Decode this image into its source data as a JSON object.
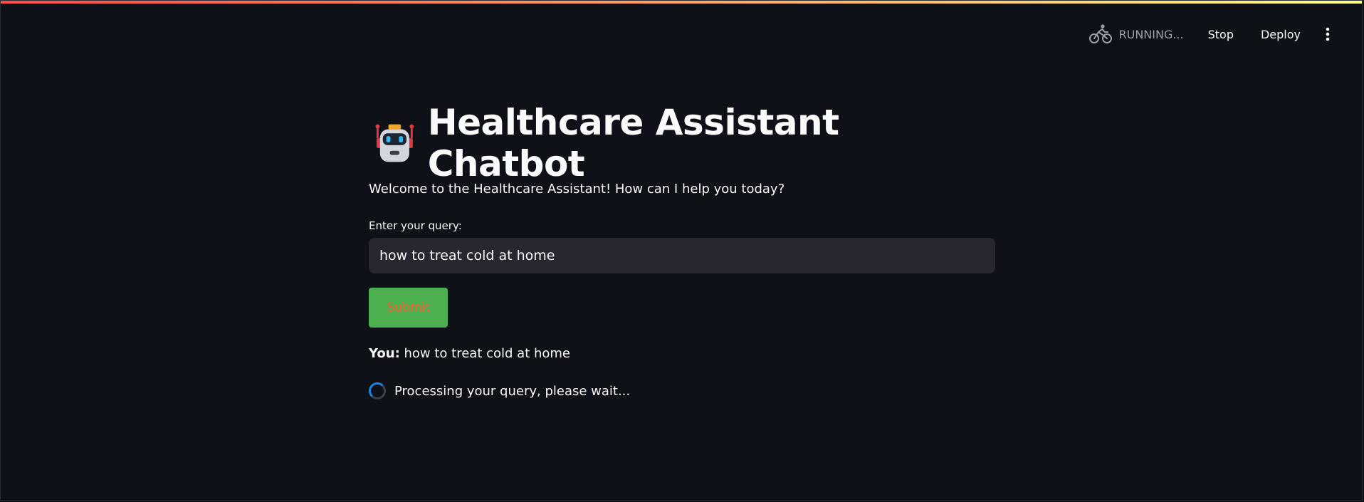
{
  "header": {
    "status_text": "RUNNING...",
    "stop_label": "Stop",
    "deploy_label": "Deploy"
  },
  "main": {
    "title": "Healthcare Assistant Chatbot",
    "title_icon": "robot-icon",
    "welcome": "Welcome to the Healthcare Assistant! How can I help you today?",
    "input_label": "Enter your query:",
    "query_value": "how to treat cold at home",
    "submit_label": "Submit",
    "you_prefix": "You:",
    "you_query": "how to treat cold at home",
    "processing_text": "Processing your query, please wait..."
  },
  "colors": {
    "background": "#0e1117",
    "input_bg": "#262730",
    "submit_bg": "#4caf50",
    "submit_text": "#ff5a2a",
    "spinner": "#1c83e1"
  }
}
